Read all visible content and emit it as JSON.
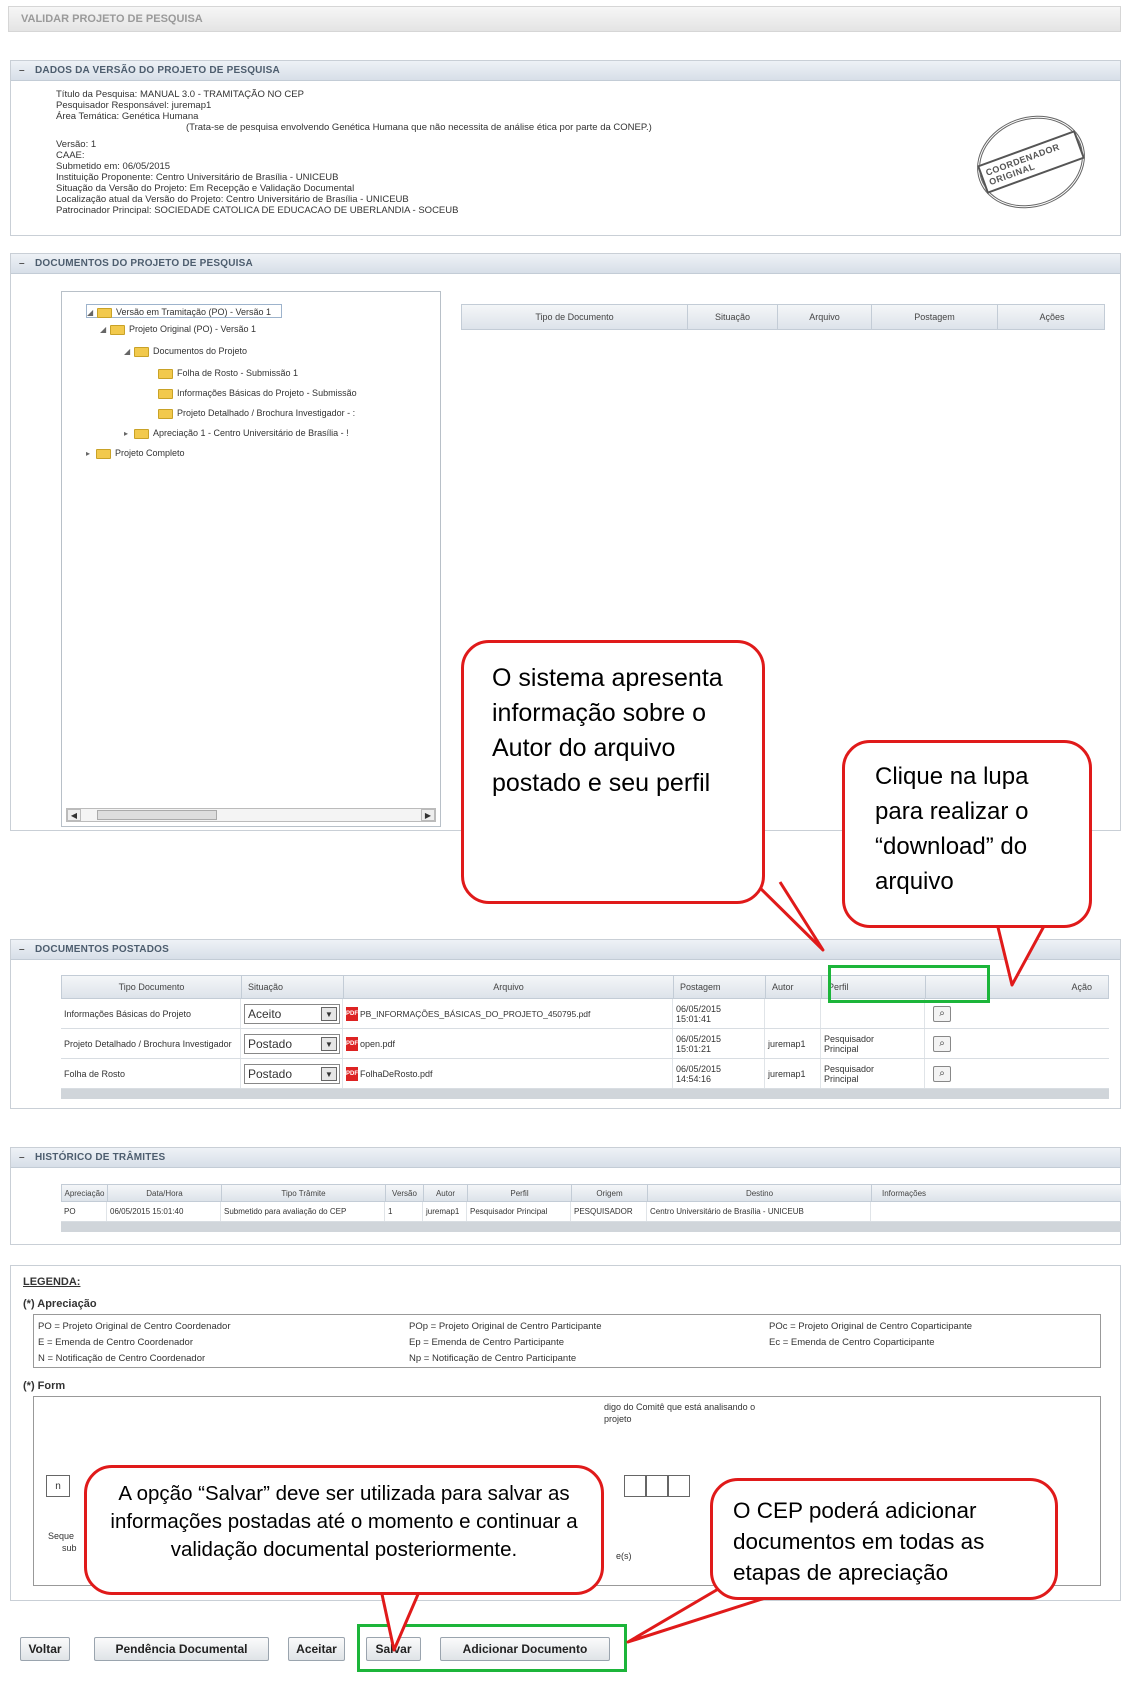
{
  "page_title": "VALIDAR PROJETO DE PESQUISA",
  "sections": {
    "dados": "DADOS DA VERSÃO DO PROJETO DE PESQUISA",
    "documentos": "DOCUMENTOS DO PROJETO DE PESQUISA",
    "postados": "DOCUMENTOS POSTADOS",
    "historico": "HISTÓRICO DE TRÂMITES"
  },
  "dados": {
    "lines": [
      "Título da Pesquisa: MANUAL 3.0 - TRAMITAÇÃO NO CEP",
      "Pesquisador Responsável: juremap1",
      "Área Temática:      Genética Humana",
      "                (Trata-se de pesquisa envolvendo Genética Humana que não necessita de análise ética por parte da CONEP.)",
      "Versão: 1",
      "CAAE:",
      "Submetido em: 06/05/2015",
      "Instituição Proponente: Centro Universitário de Brasília - UNICEUB",
      "Situação da Versão do Projeto: Em Recepção e Validação Documental",
      "Localização atual da Versão do Projeto: Centro Universitário de Brasília - UNICEUB",
      "Patrocinador Principal:      SOCIEDADE CATOLICA DE EDUCACAO DE UBERLANDIA - SOCEUB"
    ],
    "stamp_text": "COORDENADOR ORIGINAL"
  },
  "tree": [
    "Versão em Tramitação (PO) - Versão 1",
    "Projeto Original (PO) - Versão 1",
    "Documentos do Projeto",
    "Folha de Rosto - Submissão 1",
    "Informações Básicas do Projeto - Submissão",
    "Projeto Detalhado / Brochura Investigador - :",
    "Apreciação 1 - Centro Universitário de Brasília - !",
    "Projeto Completo"
  ],
  "doc_table_headers": [
    "Tipo de Documento",
    "Situação",
    "Arquivo",
    "Postagem",
    "Ações"
  ],
  "postados": {
    "headers": [
      "Tipo Documento",
      "Situação",
      "Arquivo",
      "Postagem",
      "Autor",
      "Perfil",
      "Ação"
    ],
    "rows": [
      {
        "tipo": "Informações Básicas do Projeto",
        "situacao": "Aceito",
        "arquivo": "PB_INFORMAÇÕES_BÁSICAS_DO_PROJETO_450795.pdf",
        "postagem1": "06/05/2015",
        "postagem2": "15:01:41",
        "autor": "",
        "perfil1": "",
        "perfil2": ""
      },
      {
        "tipo": "Projeto Detalhado / Brochura Investigador",
        "situacao": "Postado",
        "arquivo": "open.pdf",
        "postagem1": "06/05/2015",
        "postagem2": "15:01:21",
        "autor": "juremap1",
        "perfil1": "Pesquisador",
        "perfil2": "Principal"
      },
      {
        "tipo": "Folha de Rosto",
        "situacao": "Postado",
        "arquivo": "FolhaDeRosto.pdf",
        "postagem1": "06/05/2015",
        "postagem2": "14:54:16",
        "autor": "juremap1",
        "perfil1": "Pesquisador",
        "perfil2": "Principal"
      }
    ]
  },
  "historico": {
    "headers": [
      "Apreciação",
      "Data/Hora",
      "Tipo Trâmite",
      "Versão",
      "Autor",
      "Perfil",
      "Origem",
      "Destino",
      "Informações"
    ],
    "row": [
      "PO",
      "06/05/2015 15:01:40",
      "Submetido para avaliação do CEP",
      "1",
      "juremap1",
      "Pesquisador Principal",
      "PESQUISADOR",
      "Centro Universitário de Brasília - UNICEUB",
      ""
    ]
  },
  "legenda": {
    "title": "LEGENDA:",
    "apreciacao_title": "(*) Apreciação",
    "col1": [
      "PO = Projeto Original de Centro Coordenador",
      "E = Emenda de Centro Coordenador",
      "N = Notificação de Centro Coordenador"
    ],
    "col2": [
      "POp = Projeto Original de Centro Participante",
      "Ep = Emenda de Centro Participante",
      "Np = Notificação de Centro Participante"
    ],
    "col3": [
      "POc = Projeto Original de Centro Coparticipante",
      "Ec = Emenda de Centro Coparticipante"
    ],
    "formato_title": "(*) Form",
    "comite_label": "digo do Comitê que está analisando o projeto",
    "box_n": "n",
    "seq_label": "Seque",
    "seq_label2": "sub",
    "tail": "e(s)"
  },
  "buttons": {
    "voltar": "Voltar",
    "pendencia": "Pendência Documental",
    "aceitar": "Aceitar",
    "salvar": "Salvar",
    "adicionar": "Adicionar Documento"
  },
  "callouts": {
    "autor": "O sistema apresenta informação sobre o Autor do arquivo postado e seu perfil",
    "lupa": "Clique na lupa para realizar o “download” do arquivo",
    "salvar": "A opção “Salvar” deve ser utilizada para salvar as informações postadas até o momento e continuar a validação documental posteriormente.",
    "cep": "O CEP poderá adicionar documentos em todas as etapas de apreciação"
  },
  "colors": {
    "callout_border": "#e01a1a",
    "highlight": "#1cb53a"
  }
}
